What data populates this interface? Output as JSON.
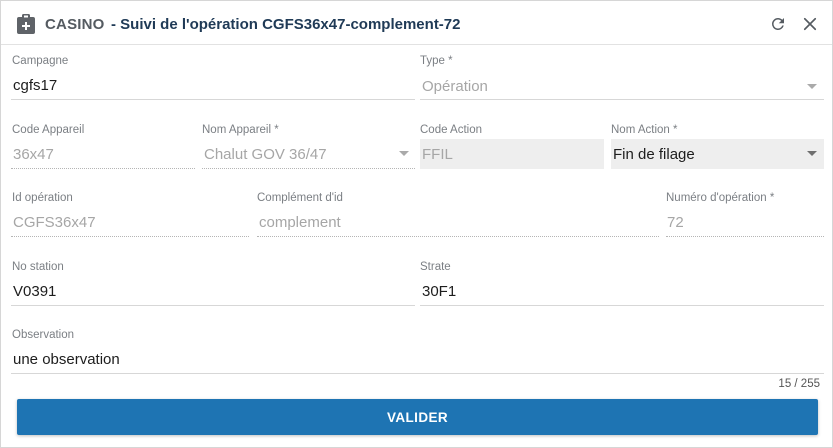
{
  "header": {
    "app_name": "CASINO",
    "title": "- Suivi de l'opération CGFS36x47-complement-72",
    "icons": [
      "clipboard-plus-icon",
      "refresh-icon",
      "close-icon"
    ]
  },
  "form": {
    "campagne": {
      "label": "Campagne",
      "value": "cgfs17"
    },
    "type": {
      "label": "Type *",
      "placeholder": "Opération"
    },
    "code_appareil": {
      "label": "Code Appareil",
      "value": "36x47"
    },
    "nom_appareil": {
      "label": "Nom Appareil *",
      "value": "Chalut GOV 36/47"
    },
    "code_action": {
      "label": "Code Action",
      "value": "FFIL"
    },
    "nom_action": {
      "label": "Nom Action *",
      "value": "Fin de filage"
    },
    "id_operation": {
      "label": "Id opération",
      "value": "CGFS36x47"
    },
    "complement_id": {
      "label": "Complément d'id",
      "value": "complement"
    },
    "numero_operation": {
      "label": "Numéro d'opération *",
      "value": "72"
    },
    "no_station": {
      "label": "No station",
      "value": "V0391"
    },
    "strate": {
      "label": "Strate",
      "value": "30F1"
    },
    "observation": {
      "label": "Observation",
      "value": "une observation",
      "counter": "15 / 255"
    }
  },
  "actions": {
    "submit_label": "VALIDER"
  },
  "colors": {
    "primary": "#1e74b3",
    "title": "#1f3a56",
    "disabled_bg": "#eeeeee"
  }
}
